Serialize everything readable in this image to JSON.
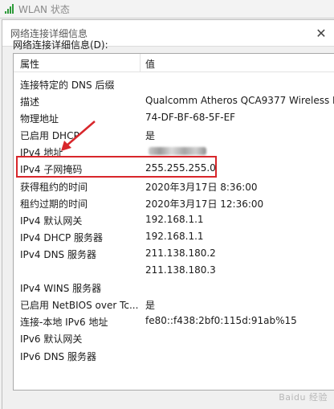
{
  "background_window": {
    "title": "WLAN 状态"
  },
  "dialog": {
    "title": "网络连接详细信息",
    "section_label": "网络连接详细信息(D):",
    "columns": {
      "property": "属性",
      "value": "值"
    },
    "rows": [
      {
        "property": "连接特定的 DNS 后缀",
        "value": ""
      },
      {
        "property": "描述",
        "value": "Qualcomm Atheros QCA9377 Wireless N"
      },
      {
        "property": "物理地址",
        "value": "74-DF-BF-68-5F-EF"
      },
      {
        "property": "已启用 DHCP",
        "value": "是"
      },
      {
        "property": "IPv4 地址",
        "value": ""
      },
      {
        "property": "IPv4 子网掩码",
        "value": "255.255.255.0"
      },
      {
        "property": "获得租约的时间",
        "value": "2020年3月17日 8:36:00"
      },
      {
        "property": "租约过期的时间",
        "value": "2020年3月17日 12:36:00"
      },
      {
        "property": "IPv4 默认网关",
        "value": "192.168.1.1"
      },
      {
        "property": "IPv4 DHCP 服务器",
        "value": "192.168.1.1"
      },
      {
        "property": "IPv4 DNS 服务器",
        "value": "211.138.180.2"
      },
      {
        "property": "",
        "value": "211.138.180.3"
      },
      {
        "property": "IPv4 WINS 服务器",
        "value": ""
      },
      {
        "property": "已启用 NetBIOS over Tc...",
        "value": "是"
      },
      {
        "property": "连接-本地 IPv6 地址",
        "value": "fe80::f438:2bf0:115d:91ab%15"
      },
      {
        "property": "IPv6 默认网关",
        "value": ""
      },
      {
        "property": "IPv6 DNS 服务器",
        "value": ""
      }
    ]
  },
  "colors": {
    "highlight": "#d8262b",
    "signal": "#2e9b3a"
  },
  "watermark": "Baidu 经验"
}
